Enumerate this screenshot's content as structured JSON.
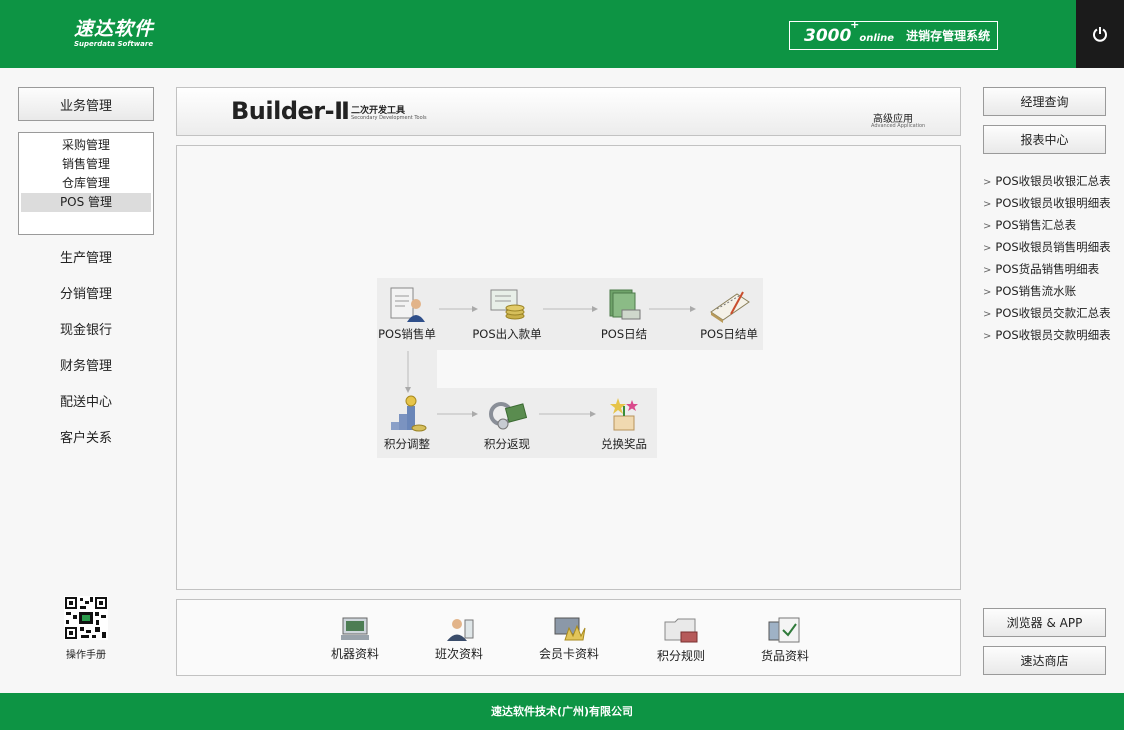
{
  "header": {
    "logo_cn": "速达软件",
    "logo_en": "Superdata Software",
    "sys_number": "3000",
    "sys_plus": "+",
    "sys_online": "online",
    "sys_name": "进销存管理系统"
  },
  "left": {
    "main_button": "业务管理",
    "submenu": [
      "采购管理",
      "销售管理",
      "仓库管理",
      "POS 管理"
    ],
    "nav": [
      "生产管理",
      "分销管理",
      "现金银行",
      "财务管理",
      "配送中心",
      "客户关系"
    ],
    "manual_label": "操作手册"
  },
  "banner": {
    "title": "Builder-Ⅱ",
    "subtitle_cn": "二次开发工具",
    "subtitle_en": "Secondary Development Tools",
    "advanced_cn": "高级应用",
    "advanced_en": "Advanced Application"
  },
  "flow": {
    "row1": [
      "POS销售单",
      "POS出入款单",
      "POS日结",
      "POS日结单"
    ],
    "row2": [
      "积分调整",
      "积分返现",
      "兑换奖品"
    ]
  },
  "bottom": {
    "items": [
      "机器资料",
      "班次资料",
      "会员卡资料",
      "积分规则",
      "货品资料"
    ]
  },
  "right": {
    "manager_query": "经理查询",
    "report_center": "报表中心",
    "reports": [
      "POS收银员收银汇总表",
      "POS收银员收银明细表",
      "POS销售汇总表",
      "POS收银员销售明细表",
      "POS货品销售明细表",
      "POS销售流水账",
      "POS收银员交款汇总表",
      "POS收银员交款明细表"
    ],
    "browser_app": "浏览器 & APP",
    "store": "速达商店"
  },
  "footer": {
    "company": "速达软件技术(广州)有限公司"
  }
}
